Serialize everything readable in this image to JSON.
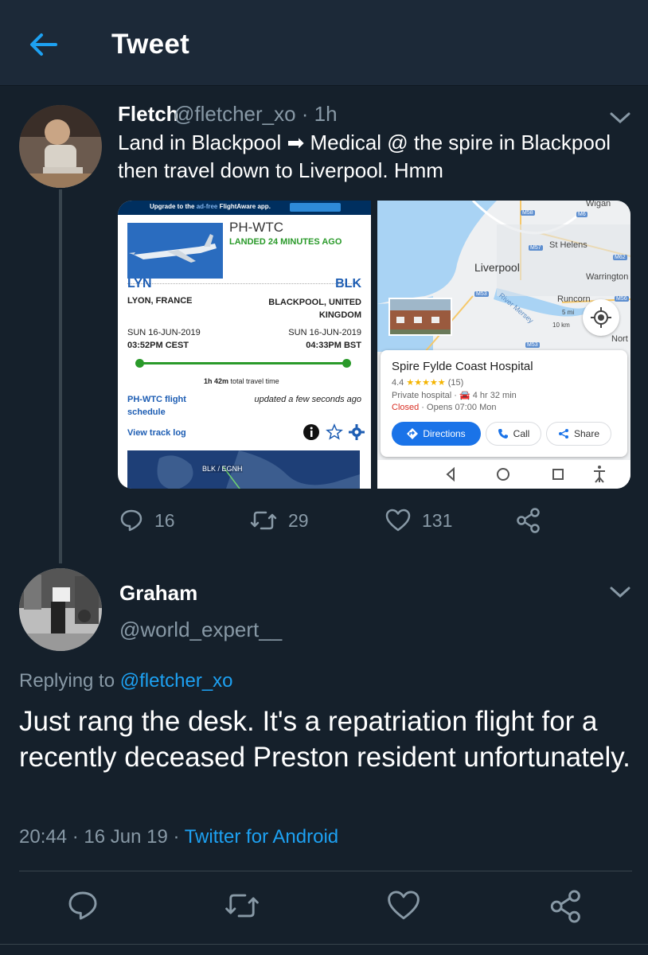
{
  "header": {
    "title": "Tweet"
  },
  "tweet1": {
    "name": "Fletch",
    "handle_time": "@fletcher_xo · 1h",
    "text": "Land in Blackpool ➡ Medical @ the spire in Blackpool then travel down to Liverpool. Hmm",
    "replies": "16",
    "retweets": "29",
    "likes": "131"
  },
  "flightaware": {
    "banner": "Upgrade to the",
    "banner_sub": "ad-free",
    "banner_end": "FlightAware app.",
    "registration": "PH-WTC",
    "status": "LANDED 24 MINUTES AGO",
    "origin_code": "LYN",
    "dest_code": "BLK",
    "origin_city": "LYON, FRANCE",
    "dest_city": "BLACKPOOL, UNITED KINGDOM",
    "origin_date": "SUN 16-JUN-2019",
    "dest_date": "SUN 16-JUN-2019",
    "origin_time": "03:52PM CEST",
    "dest_time": "04:33PM BST",
    "total_time_bold": "1h 42m",
    "total_time_rest": "total travel time",
    "schedule_link": "PH-WTC flight schedule",
    "updated": "updated a few seconds ago",
    "track_log": "View track log",
    "map_label": "BLK / EGNH"
  },
  "googlemap": {
    "labels": {
      "wigan": "Wigan",
      "st_helens": "St Helens",
      "liverpool": "Liverpool",
      "warrington": "Warrington",
      "runcorn": "Runcorn",
      "river": "River Mersey",
      "north": "Nort",
      "scale_mi": "5 mi",
      "scale_km": "10 km"
    },
    "roads": {
      "m58": "M58",
      "m6": "M6",
      "m57": "M57",
      "m62": "M62",
      "m53a": "M53",
      "m53b": "M53",
      "m56": "M56"
    },
    "place_title": "Spire Fylde Coast Hospital",
    "rating": "4.4",
    "stars": "★★★★★",
    "reviews": "(15)",
    "type": "Private hospital · 🚘 4 hr 32 min",
    "closed": "Closed",
    "opens": " · Opens 07:00 Mon",
    "btn_directions": "Directions",
    "btn_call": "Call",
    "btn_share": "Share"
  },
  "tweet2": {
    "name": "Graham",
    "handle": "@world_expert__",
    "replying_prefix": "Replying to ",
    "replying_handle": "@fletcher_xo",
    "text": "Just rang the desk. It's a repatriation flight for a recently deceased Preston resident unfortunately.",
    "time": "20:44 · 16 Jun 19 · ",
    "client": "Twitter for Android"
  },
  "colors": {
    "background": "#15202b",
    "header": "#1c2938",
    "accent": "#1da1f2",
    "muted": "#8899a6"
  }
}
